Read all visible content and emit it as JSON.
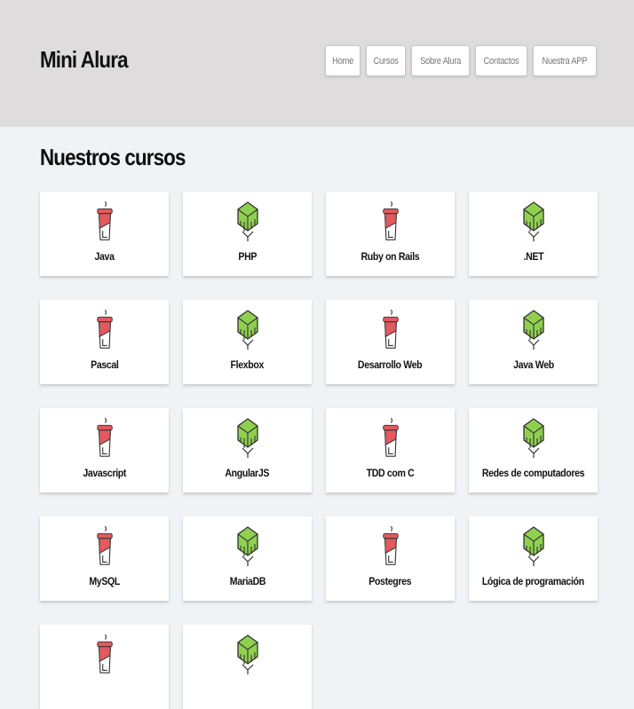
{
  "header": {
    "logo": "Mini Alura",
    "nav": [
      "Home",
      "Cursos",
      "Sobre Alura",
      "Contactos",
      "Nuestra APP"
    ]
  },
  "main": {
    "title": "Nuestros cursos",
    "courses": [
      {
        "name": "Java",
        "icon": "cup-icon"
      },
      {
        "name": "PHP",
        "icon": "cube-icon"
      },
      {
        "name": "Ruby on Rails",
        "icon": "cup-icon"
      },
      {
        "name": ".NET",
        "icon": "cube-icon"
      },
      {
        "name": "Pascal",
        "icon": "cup-icon"
      },
      {
        "name": "Flexbox",
        "icon": "cube-icon"
      },
      {
        "name": "Desarrollo Web",
        "icon": "cup-icon"
      },
      {
        "name": "Java Web",
        "icon": "cube-icon"
      },
      {
        "name": "Javascript",
        "icon": "cup-icon"
      },
      {
        "name": "AngularJS",
        "icon": "cube-icon"
      },
      {
        "name": "TDD com C",
        "icon": "cup-icon"
      },
      {
        "name": "Redes de computadores",
        "icon": "cube-icon"
      },
      {
        "name": "MySQL",
        "icon": "cup-icon"
      },
      {
        "name": "MariaDB",
        "icon": "cube-icon"
      },
      {
        "name": "Postegres",
        "icon": "cup-icon"
      },
      {
        "name": "Lógica de programación",
        "icon": "cube-icon"
      },
      {
        "name": "",
        "icon": "cup-icon"
      },
      {
        "name": "",
        "icon": "cube-icon"
      }
    ]
  },
  "colors": {
    "header_bg": "#dedcdd",
    "page_bg": "#eff3f6",
    "cup_red": "#e05a5f",
    "cube_green": "#8fd14f"
  }
}
